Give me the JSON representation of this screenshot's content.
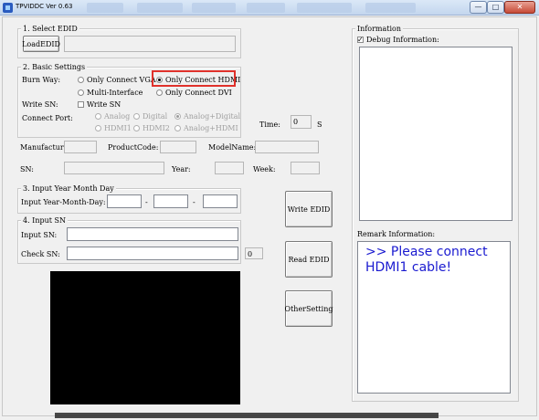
{
  "window": {
    "title": "TPVIDDC Ver 0.63",
    "controls": {
      "minimize": "—",
      "maximize": "□",
      "close": "✕"
    }
  },
  "select_edid": {
    "group_title": "1. Select EDID",
    "load_button": "LoadEDID",
    "path_value": ""
  },
  "basic_settings": {
    "group_title": "2. Basic Settings",
    "burn_way_label": "Burn Way:",
    "burn_way_options": [
      {
        "label": "Only Connect VGA",
        "selected": false
      },
      {
        "label": "Only Connect HDMI",
        "selected": true
      },
      {
        "label": "Multi-Interface",
        "selected": false
      },
      {
        "label": "Only Connect DVI",
        "selected": false
      }
    ],
    "write_sn_label": "Write SN:",
    "write_sn_checkbox": {
      "label": "Write SN",
      "checked": false
    },
    "connect_port_label": "Connect Port:",
    "connect_port_options": [
      {
        "label": "Analog",
        "selected": false
      },
      {
        "label": "Digital",
        "selected": false
      },
      {
        "label": "Analog+Digital",
        "selected": true
      },
      {
        "label": "HDMI1",
        "selected": false
      },
      {
        "label": "HDMI2",
        "selected": false
      },
      {
        "label": "Analog+HDMI",
        "selected": false
      }
    ],
    "time_label": "Time:",
    "time_value": "0",
    "time_unit": "S"
  },
  "info_fields": {
    "manufacture_label": "Manufacture:",
    "manufacture_value": "",
    "product_code_label": "ProductCode:",
    "product_code_value": "",
    "model_name_label": "ModelName:",
    "model_name_value": "",
    "sn_label": "SN:",
    "sn_value": "",
    "year_label": "Year:",
    "year_value": "",
    "week_label": "Week:",
    "week_value": ""
  },
  "input_date": {
    "group_title": "3. Input Year Month Day",
    "label": "Input Year-Month-Day:",
    "year": "",
    "month": "",
    "day": "",
    "separator": "-"
  },
  "input_sn": {
    "group_title": "4. Input SN",
    "input_label": "Input SN:",
    "input_value": "",
    "check_label": "Check SN:",
    "check_value": "",
    "count_value": "0"
  },
  "actions": {
    "write_edid": "Write EDID",
    "read_edid": "Read EDID",
    "other_setting": "OtherSetting"
  },
  "information": {
    "group_title": "Information",
    "debug_checkbox": {
      "label": "Debug Information:",
      "checked": true
    },
    "remark_label": "Remark Information:",
    "remark_text": ">> Please connect HDMI1 cable!"
  },
  "colors": {
    "highlight": "#e0312b",
    "remark_text": "#1a1ad0"
  }
}
